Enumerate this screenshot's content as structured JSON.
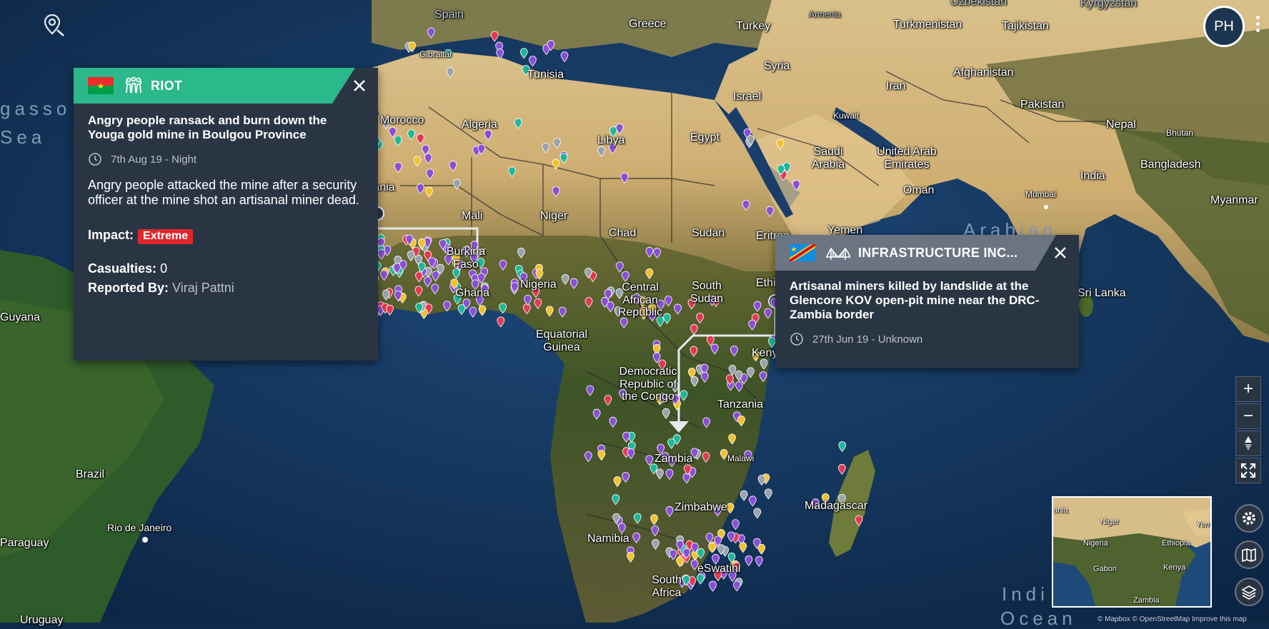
{
  "map": {
    "labels": {
      "spain": "Spain",
      "greece": "Greece",
      "armenia": "Armenia",
      "uzbekistan": "Uzbekistan",
      "kyrgyzstan": "Kyrgyzstan",
      "turkey": "Turkey",
      "turkmenistan": "Turkmenistan",
      "tajikistan": "Tajikistan",
      "gibraltar": "Gibraltar",
      "tunisia": "Tunisia",
      "syria": "Syria",
      "afghanistan": "Afghanistan",
      "iran": "Iran",
      "israel": "Israel",
      "pakistan": "Pakistan",
      "kuwait": "Kuwait",
      "morocco": "Morocco",
      "algeria": "Algeria",
      "libya": "Libya",
      "egypt": "Egypt",
      "nepal": "Nepal",
      "bhutan": "Bhutan",
      "saudi": "Saudi Arabia",
      "uae": "United Arab Emirates",
      "india": "India",
      "bangladesh": "Bangladesh",
      "mauritania": "Mauritania",
      "oman": "Oman",
      "mumbai": "Mumbai",
      "myanmar": "Myanmar",
      "mali": "Mali",
      "niger": "Niger",
      "yemen": "Yemen",
      "chad": "Chad",
      "sudan": "Sudan",
      "eritrea": "Eritrea",
      "arabian": "Arabian",
      "burkina": "Burkina Faso",
      "ethiopia": "Ethiopia",
      "nigeria": "Nigeria",
      "ghana": "Ghana",
      "car": "Central African Republic",
      "southsudan": "South Sudan",
      "srilanka": "Sri Lanka",
      "guyana": "Guyana",
      "eqguinea": "Equatorial Guinea",
      "kenya": "Kenya",
      "drc": "Democratic Republic of the Congo",
      "tanzania": "Tanzania",
      "brazil": "Brazil",
      "zambia": "Zambia",
      "malawi": "Malawi",
      "madagascar": "Madagascar",
      "zimbabwe": "Zimbabwe",
      "rio": "Rio de Janeiro",
      "paraguay": "Paraguay",
      "namibia": "Namibia",
      "eswatini": "eSwatini",
      "southafrica": "South Africa",
      "uruguay": "Uruguay",
      "indian": "Indi",
      "ocean": "Ocean",
      "sargasso": "gasso",
      "sea": "Sea"
    }
  },
  "header": {
    "locate_icon": "location-search-icon",
    "avatar_initials": "PH"
  },
  "popups": [
    {
      "category": "RIOT",
      "country_flag": "burkina-faso-flag",
      "category_icon": "people-riot-icon",
      "header_color": "#2bb88a",
      "title": "Angry people ransack and burn down the Youga gold mine in Boulgou Province",
      "time": "7th Aug 19 - Night",
      "description": "Angry people attacked the mine after a security officer at the mine shot an artisanal miner dead.",
      "impact_label": "Impact:",
      "impact_value": "Extreme",
      "casualties_label": "Casualties:",
      "casualties_value": "0",
      "reported_label": "Reported By:",
      "reported_value": "Viraj Pattni"
    },
    {
      "category": "INFRASTRUCTURE INC...",
      "country_flag": "drc-flag",
      "category_icon": "bridge-infrastructure-icon",
      "header_color": "#6b7582",
      "title": "Artisanal miners killed by landslide at the Glencore KOV open-pit mine near the DRC-Zambia border",
      "time": "27th Jun 19 - Unknown"
    }
  ],
  "controls": {
    "zoom_in": "+",
    "zoom_out": "−"
  },
  "minimap": {
    "niger": "Niger",
    "nigeria": "Nigeria",
    "ethiopia": "Ethiopia",
    "gabon": "Gabon",
    "kenya": "Kenya",
    "zambia": "Zambia",
    "yemen": "Yeme",
    "ania": "ania"
  },
  "attribution": "© Mapbox © OpenStreetMap Improve this map",
  "colors": {
    "riot": "#2bb88a",
    "infra": "#6b7582",
    "panel": "#2a3544",
    "extreme": "#e0282c",
    "pin_purple": "#8a4fd6",
    "pin_teal": "#1fb79a",
    "pin_red": "#e23a52",
    "pin_yellow": "#f2c12e",
    "pin_gray": "#9aa3ad"
  }
}
